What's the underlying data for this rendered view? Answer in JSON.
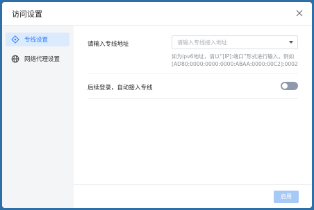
{
  "dialog": {
    "title": "访问设置"
  },
  "sidebar": {
    "items": [
      {
        "label": "专线设置",
        "icon": "dedicated-line-icon",
        "active": true
      },
      {
        "label": "网络代理设置",
        "icon": "globe-icon",
        "active": false
      }
    ]
  },
  "dedicated_line": {
    "address_label": "请输入专线地址",
    "address_placeholder": "请输入专线接入地址",
    "hint_line1": "如为ipv6地址，请以“[IP]:端口”形式进行输入，例如",
    "hint_line2": "[AD80:0000:0000:0000:ABAA:0000:00C2]:0002",
    "auto_connect_label": "后续登录，自动接入专线",
    "auto_connect_enabled": false
  },
  "footer": {
    "enable_label": "启用"
  },
  "colors": {
    "accent": "#2d7ff9",
    "sidebar_bg": "#f4f5f7",
    "active_bg": "#dbeafd",
    "disabled_button": "#a7c9f6",
    "toggle_off": "#8f98ad"
  }
}
